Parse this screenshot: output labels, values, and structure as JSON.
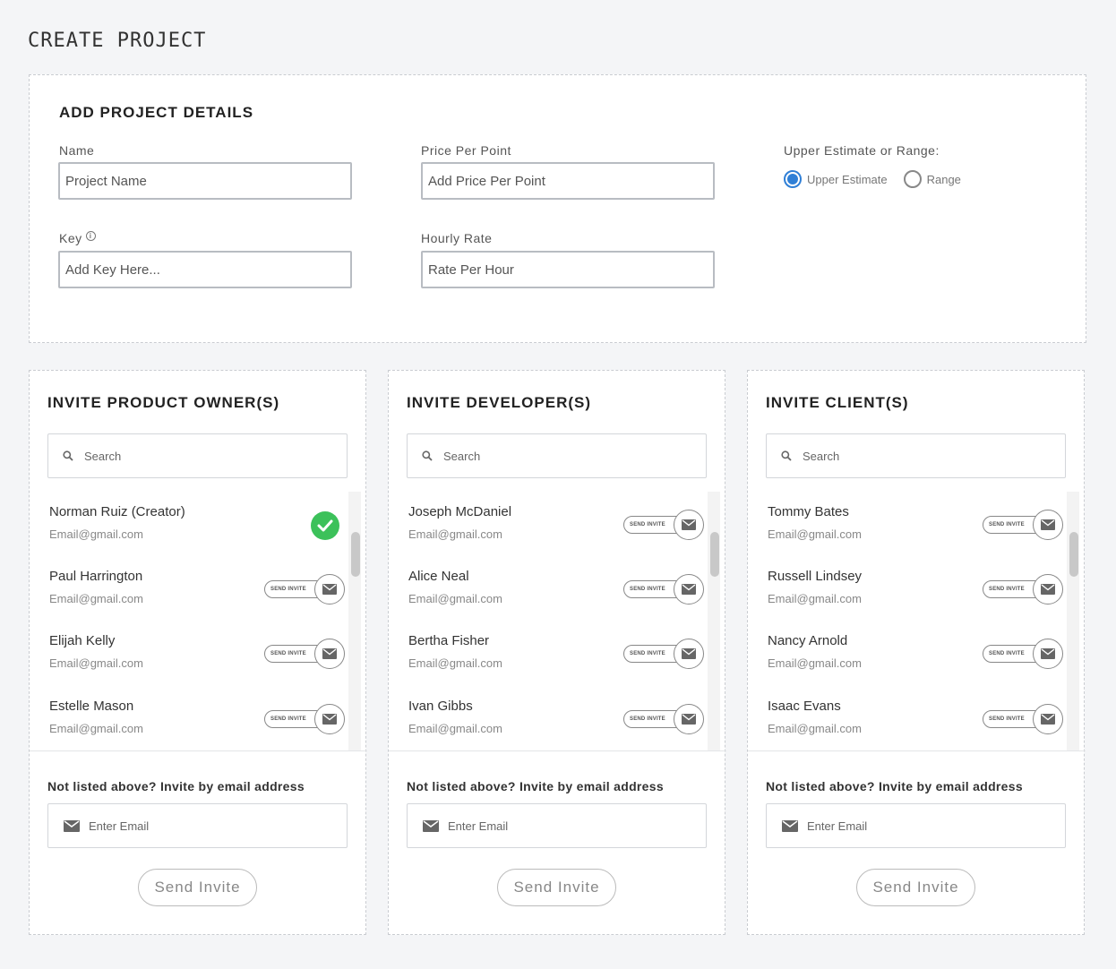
{
  "page": {
    "title": "CREATE PROJECT"
  },
  "details": {
    "title": "ADD PROJECT DETAILS",
    "name_label": "Name",
    "name_placeholder": "Project Name",
    "price_label": "Price Per Point",
    "price_placeholder": "Add Price Per Point",
    "estimate_label": "Upper Estimate or Range:",
    "options": [
      {
        "label": "Upper Estimate",
        "selected": true
      },
      {
        "label": "Range",
        "selected": false
      }
    ],
    "key_label": "Key",
    "key_placeholder": "Add Key Here...",
    "hourly_label": "Hourly Rate",
    "hourly_placeholder": "Rate Per Hour"
  },
  "common": {
    "search_placeholder": "Search",
    "not_listed_label": "Not listed above? Invite by email address",
    "email_placeholder": "Enter Email",
    "send_invite_label": "Send Invite",
    "pill_label": "SEND INVITE"
  },
  "cards": [
    {
      "title": "INVITE PRODUCT OWNER(S)",
      "members": [
        {
          "name": "Norman Ruiz (Creator)",
          "email": "Email@gmail.com",
          "status": "invited"
        },
        {
          "name": "Paul Harrington",
          "email": "Email@gmail.com",
          "status": "pending"
        },
        {
          "name": "Elijah Kelly",
          "email": "Email@gmail.com",
          "status": "pending"
        },
        {
          "name": "Estelle Mason",
          "email": "Email@gmail.com",
          "status": "pending"
        }
      ]
    },
    {
      "title": "INVITE DEVELOPER(S)",
      "members": [
        {
          "name": "Joseph McDaniel",
          "email": "Email@gmail.com",
          "status": "pending"
        },
        {
          "name": "Alice Neal",
          "email": "Email@gmail.com",
          "status": "pending"
        },
        {
          "name": "Bertha Fisher",
          "email": "Email@gmail.com",
          "status": "pending"
        },
        {
          "name": "Ivan Gibbs",
          "email": "Email@gmail.com",
          "status": "pending"
        }
      ]
    },
    {
      "title": "INVITE CLIENT(S)",
      "members": [
        {
          "name": "Tommy Bates",
          "email": "Email@gmail.com",
          "status": "pending"
        },
        {
          "name": "Russell Lindsey",
          "email": "Email@gmail.com",
          "status": "pending"
        },
        {
          "name": "Nancy Arnold",
          "email": "Email@gmail.com",
          "status": "pending"
        },
        {
          "name": "Isaac Evans",
          "email": "Email@gmail.com",
          "status": "pending"
        }
      ]
    }
  ],
  "colors": {
    "accent": "#2f7fd6",
    "success": "#3cc15a",
    "background": "#f4f5f7"
  }
}
